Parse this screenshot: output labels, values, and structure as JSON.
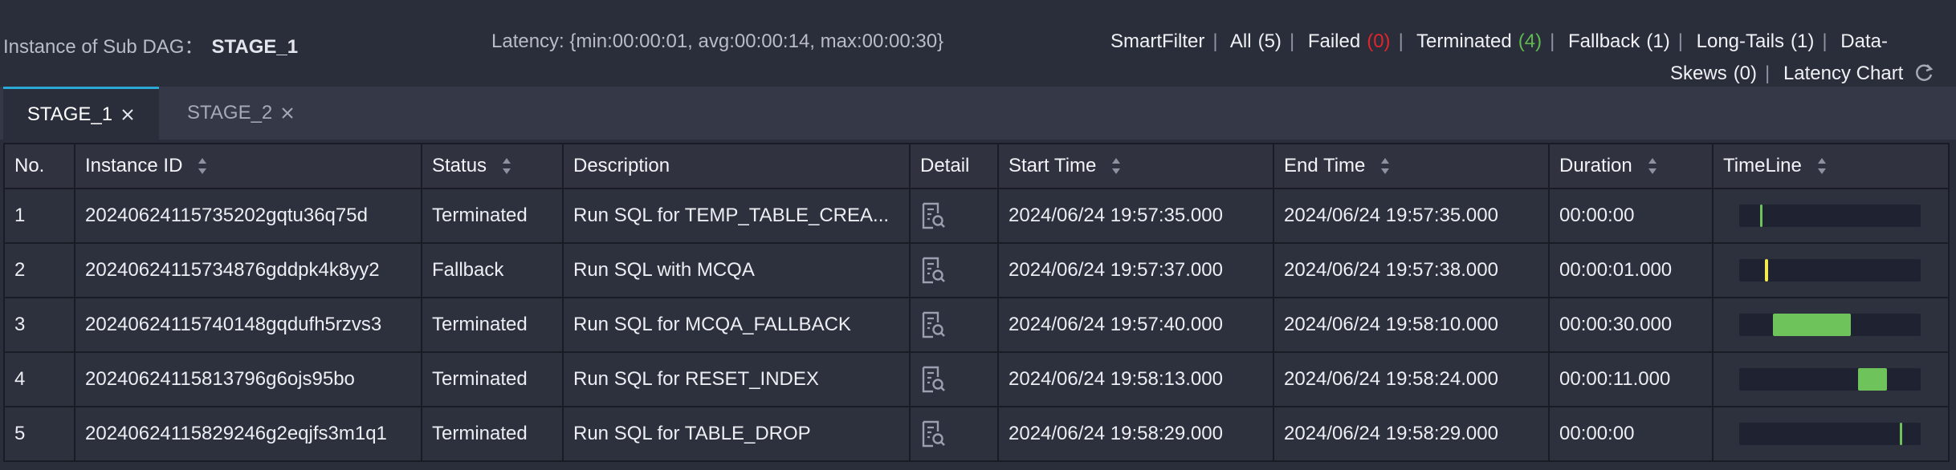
{
  "header": {
    "title_prefix": "Instance of Sub DAG：",
    "title_stage": "STAGE_1",
    "latency": "Latency: {min:00:00:01, avg:00:00:14, max:00:00:30}"
  },
  "filters": {
    "label": "SmartFilter",
    "items": [
      {
        "label": "All",
        "count": "(5)"
      },
      {
        "label": "Failed",
        "count": "(0)"
      },
      {
        "label": "Terminated",
        "count": "(4)"
      },
      {
        "label": "Fallback",
        "count": "(1)"
      },
      {
        "label": "Long-Tails",
        "count": "(1)"
      },
      {
        "label": "Data-",
        "label2": "Skews",
        "count": "(0)"
      }
    ],
    "latency_chart": "Latency Chart"
  },
  "tabs": [
    {
      "label": "STAGE_1",
      "active": true
    },
    {
      "label": "STAGE_2",
      "active": false
    }
  ],
  "table": {
    "columns": [
      "No.",
      "Instance ID",
      "Status",
      "Description",
      "Detail",
      "Start Time",
      "End Time",
      "Duration",
      "TimeLine"
    ],
    "rows": [
      {
        "no": "1",
        "id": "20240624115735202gqtu36q75d",
        "status": "Terminated",
        "desc": "Run SQL for TEMP_TABLE_CREA...",
        "start": "2024/06/24 19:57:35.000",
        "end": "2024/06/24 19:57:35.000",
        "duration": "00:00:00"
      },
      {
        "no": "2",
        "id": "20240624115734876gddpk4k8yy2",
        "status": "Fallback",
        "desc": "Run SQL with MCQA",
        "start": "2024/06/24 19:57:37.000",
        "end": "2024/06/24 19:57:38.000",
        "duration": "00:00:01.000"
      },
      {
        "no": "3",
        "id": "20240624115740148gqdufh5rzvs3",
        "status": "Terminated",
        "desc": "Run SQL for MCQA_FALLBACK",
        "start": "2024/06/24 19:57:40.000",
        "end": "2024/06/24 19:58:10.000",
        "duration": "00:00:30.000"
      },
      {
        "no": "4",
        "id": "20240624115813796g6ojs95bo",
        "status": "Terminated",
        "desc": "Run SQL for RESET_INDEX",
        "start": "2024/06/24 19:58:13.000",
        "end": "2024/06/24 19:58:24.000",
        "duration": "00:00:11.000"
      },
      {
        "no": "5",
        "id": "20240624115829246g2eqjfs3m1q1",
        "status": "Terminated",
        "desc": "Run SQL for TABLE_DROP",
        "start": "2024/06/24 19:58:29.000",
        "end": "2024/06/24 19:58:29.000",
        "duration": "00:00:00"
      }
    ]
  },
  "colors": {
    "terminated": "#6ec35b",
    "fallback": "#f2ea4e",
    "failed": "#e0262c",
    "accent": "#2aa9d6"
  },
  "icons": {
    "sort": "sort-icon",
    "detail": "detail-document-search-icon",
    "close": "close-icon",
    "refresh": "refresh-icon"
  }
}
